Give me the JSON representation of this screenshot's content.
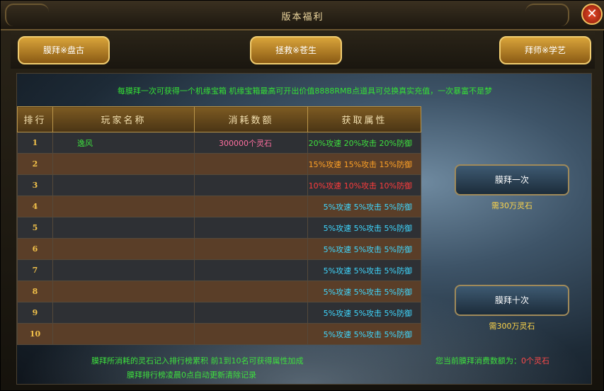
{
  "window": {
    "title": "版本福利",
    "close_label": "✕"
  },
  "tabs": [
    {
      "label": "膜拜※盘古"
    },
    {
      "label": "拯救※苍生"
    },
    {
      "label": "拜师※学艺"
    }
  ],
  "info_text": "每膜拜一次可获得一个机缘宝箱 机缘宝箱最高可开出价值8888RMB点道具可兑换真实充值，一次暴富不是梦",
  "table": {
    "headers": [
      "排行",
      "玩家名称",
      "消耗数额",
      "获取属性"
    ],
    "rows": [
      {
        "rank": "1",
        "name": "逸风",
        "cost": "300000个灵石",
        "attr": "20%攻速 20%攻击 20%防御",
        "attr_color": "#3ee03e"
      },
      {
        "rank": "2",
        "name": "",
        "cost": "",
        "attr": "15%攻速 15%攻击 15%防御",
        "attr_color": "#ffa126"
      },
      {
        "rank": "3",
        "name": "",
        "cost": "",
        "attr": "10%攻速 10%攻击 10%防御",
        "attr_color": "#ff3c3c"
      },
      {
        "rank": "4",
        "name": "",
        "cost": "",
        "attr": "5%攻速 5%攻击 5%防御",
        "attr_color": "#3fd7ff"
      },
      {
        "rank": "5",
        "name": "",
        "cost": "",
        "attr": "5%攻速 5%攻击 5%防御",
        "attr_color": "#3fd7ff"
      },
      {
        "rank": "6",
        "name": "",
        "cost": "",
        "attr": "5%攻速 5%攻击 5%防御",
        "attr_color": "#3fd7ff"
      },
      {
        "rank": "7",
        "name": "",
        "cost": "",
        "attr": "5%攻速 5%攻击 5%防御",
        "attr_color": "#3fd7ff"
      },
      {
        "rank": "8",
        "name": "",
        "cost": "",
        "attr": "5%攻速 5%攻击 5%防御",
        "attr_color": "#3fd7ff"
      },
      {
        "rank": "9",
        "name": "",
        "cost": "",
        "attr": "5%攻速 5%攻击 5%防御",
        "attr_color": "#3fd7ff"
      },
      {
        "rank": "10",
        "name": "",
        "cost": "",
        "attr": "5%攻速 5%攻击 5%防御",
        "attr_color": "#3fd7ff"
      }
    ]
  },
  "actions": [
    {
      "label": "膜拜一次",
      "cost": "需30万灵石"
    },
    {
      "label": "膜拜十次",
      "cost": "需300万灵石"
    }
  ],
  "notes": {
    "line1": "膜拜所消耗的灵石记入排行榜累积 前1到10名可获得属性加成",
    "line2": "膜拜排行榜凌晨0点自动更新清除记录"
  },
  "total": {
    "label": "您当前膜拜消费数额为：",
    "value": "0个灵石"
  }
}
